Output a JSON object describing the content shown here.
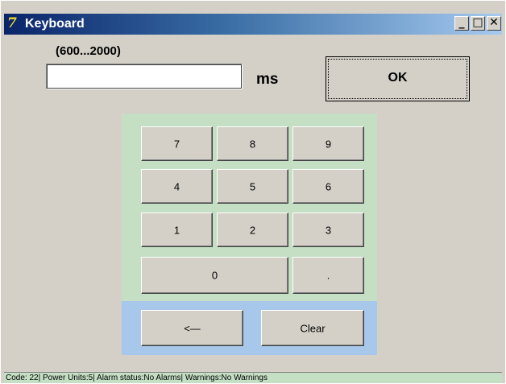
{
  "window": {
    "title": "Keyboard",
    "icon": "app-logo-icon",
    "icon_glyph": "7",
    "controls": {
      "minimize": "_",
      "maximize": "□",
      "close": "✕"
    }
  },
  "input": {
    "range_label": "(600...2000)",
    "value": "",
    "unit": "ms"
  },
  "ok_label": "OK",
  "keypad": {
    "keys": [
      "7",
      "8",
      "9",
      "4",
      "5",
      "6",
      "1",
      "2",
      "3",
      "0",
      "."
    ]
  },
  "actions": {
    "backspace_label": "<—",
    "clear_label": "Clear"
  },
  "status": {
    "text": "Code: 22| Power Units:5| Alarm status:No Alarms| Warnings:No Warnings"
  },
  "colors": {
    "titlebar": "#0a246a",
    "numpad_bg": "#c4dfc4",
    "actionpad_bg": "#a7c8ea",
    "window_bg": "#d4d0c8"
  }
}
